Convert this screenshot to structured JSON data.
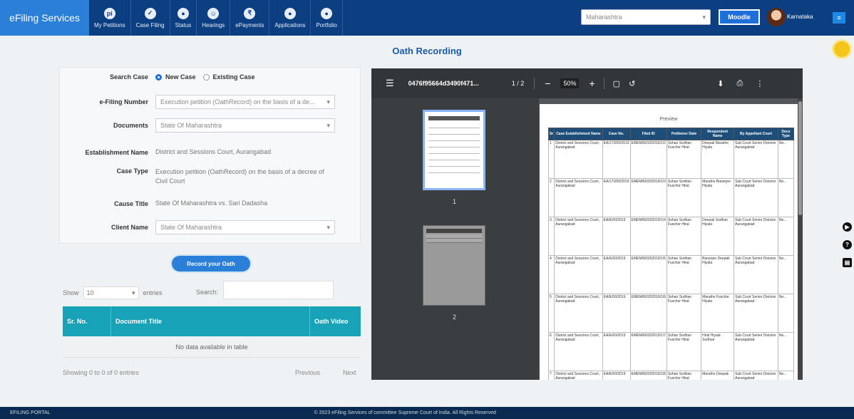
{
  "app": {
    "brand": "eFiling Services"
  },
  "nav": [
    {
      "label": "My Petitions",
      "icon": "pi"
    },
    {
      "label": "Case Filing",
      "icon": "✓"
    },
    {
      "label": "Status",
      "icon": "●"
    },
    {
      "label": "Hearings",
      "icon": "☺"
    },
    {
      "label": "ePayments",
      "icon": "₹"
    },
    {
      "label": "Applications",
      "icon": "●"
    },
    {
      "label": "Portfolio",
      "icon": "●"
    }
  ],
  "header": {
    "establishment_placeholder": "Maharashtra",
    "blue_button": "Moodle",
    "username": "Karnataka",
    "menu_icon": "≡"
  },
  "page": {
    "title": "Oath Recording"
  },
  "form": {
    "search_case_label": "Search Case",
    "radio_new": "New Case",
    "radio_existing": "Existing Case",
    "efiling_label": "e-Filing Number",
    "efiling_value": "Execution petition (OathRecord) on the basis of a de...",
    "documents_label": "Documents",
    "documents_value": "State Of Maharashtra",
    "establishment_label": "Establishment Name",
    "establishment_value": "District and Sessions Court, Aurangabad",
    "case_type_label": "Case Type",
    "case_type_value": "Execution petition (OathRecord) on the basis of a decree of Civil Court",
    "case_title_label": "Cause Title",
    "case_title_value": "State Of Maharashtra vs. Sari Dadasha",
    "client_label": "Client Name",
    "client_value": "State Of Maharashtra"
  },
  "record_button": "Record your Oath",
  "datatable": {
    "show": "Show",
    "length": "10",
    "entries": "entries",
    "search": "Search:",
    "columns": [
      "Sr. No.",
      "Document Title",
      "Oath Video"
    ],
    "empty": "No data available in table",
    "info": "Showing 0 to 0 of 0 entries",
    "prev": "Previous",
    "next": "Next"
  },
  "pdf": {
    "filename": "0476f95664d3490f471...",
    "page_indicator": "1 / 2",
    "zoom": "50%",
    "page_heading": "Preview",
    "thumb1_num": "1",
    "thumb2_num": "2",
    "table_headers": [
      "Sr",
      "Case Establishment Name",
      "Case No.",
      "Filed ID",
      "Petitioner Date",
      "Respondent Name",
      "By Appellant Court",
      "Docs Type"
    ],
    "rows": [
      [
        "1",
        "District and Sessions Court, Aurangabad",
        "EA/172/00/2019",
        "EMEM060202019/1/2",
        "Sohan Sodhan Fuschor Hiral",
        "Deepak Marathe Hiyala",
        "Sub Court Senior Division Aurangabad",
        "Ne..."
      ],
      [
        "2",
        "District and Sessions Court, Aurangabad",
        "EA/172/00/2019",
        "EMEM060202019/1/3",
        "Sohan Sodhan Fuschor Hiral",
        "Marathe Banerjee Hiyala",
        "Sub Court Senior Division Aurangabad",
        "Ne..."
      ],
      [
        "3",
        "District and Sessions Court, Aurangabad",
        "EA/E/00/2019",
        "EMEM060202019/1/4",
        "Sohan Sodhan Fuschor Hiral",
        "Deepak Sodhan Hiyala",
        "Sub Court Senior Division Aurangabad",
        "Ne..."
      ],
      [
        "4",
        "District and Sessions Court, Aurangabad",
        "EA/E/00/2019",
        "EMEM060202019/1/5",
        "Sohan Sodhan Fuschor Hiral",
        "Banerjee Deepak Hiyala",
        "Sub Court Senior Division Aurangabad",
        "Ne..."
      ],
      [
        "5",
        "District and Sessions Court, Aurangabad",
        "EA/E/00/2019",
        "EMEM060202019/1/6",
        "Sohan Sodhan Fuschor Hiral",
        "Marathe Fuschor Hiyala",
        "Sub Court Senior Division Aurangabad",
        "Ne..."
      ],
      [
        "6",
        "District and Sessions Court, Aurangabad",
        "EA/E/00/2019",
        "EMEM060202019/1/7",
        "Sohan Sodhan Fuschor Hiral",
        "Hiral Hiyala Sodhan",
        "Sub Court Senior Division Aurangabad",
        "Ne..."
      ],
      [
        "7",
        "District and Sessions Court, Aurangabad",
        "EA/E/00/2019",
        "EMEM060202019/1/8",
        "Sohan Sodhan Fuschor Hiral",
        "Marathe Deepak",
        "Sub Court Senior Division Aurangabad",
        "Ne..."
      ]
    ]
  },
  "footer": {
    "left": "EFILING PORTAL",
    "center": "© 2023 eFiling Services of committee Supreme Court of India. All Rights Reserved"
  }
}
